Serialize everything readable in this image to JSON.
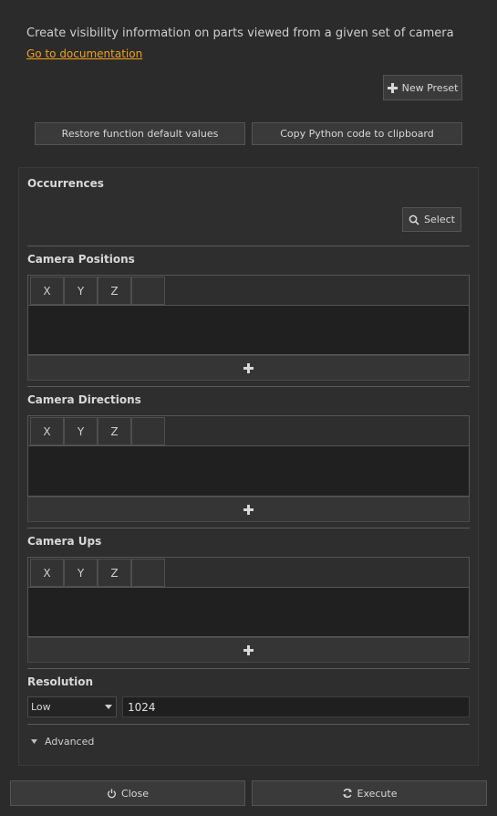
{
  "header": {
    "description": "Create visibility information on parts viewed from a given set of camera",
    "doc_link": "Go to documentation"
  },
  "toolbar": {
    "new_preset": "New Preset",
    "restore_defaults": "Restore function default values",
    "copy_python": "Copy Python code to clipboard"
  },
  "occurrences": {
    "title": "Occurrences",
    "select_label": "Select"
  },
  "camera_positions": {
    "title": "Camera Positions",
    "columns": [
      "X",
      "Y",
      "Z"
    ]
  },
  "camera_directions": {
    "title": "Camera Directions",
    "columns": [
      "X",
      "Y",
      "Z"
    ]
  },
  "camera_ups": {
    "title": "Camera Ups",
    "columns": [
      "X",
      "Y",
      "Z"
    ]
  },
  "resolution": {
    "title": "Resolution",
    "selected": "Low",
    "value": "1024"
  },
  "advanced": {
    "label": "Advanced"
  },
  "footer": {
    "close": "Close",
    "execute": "Execute"
  },
  "icons": {
    "plus": "plus-icon",
    "search": "search-icon",
    "power": "power-icon",
    "refresh": "refresh-icon",
    "triangle_down": "triangle-down-icon"
  }
}
